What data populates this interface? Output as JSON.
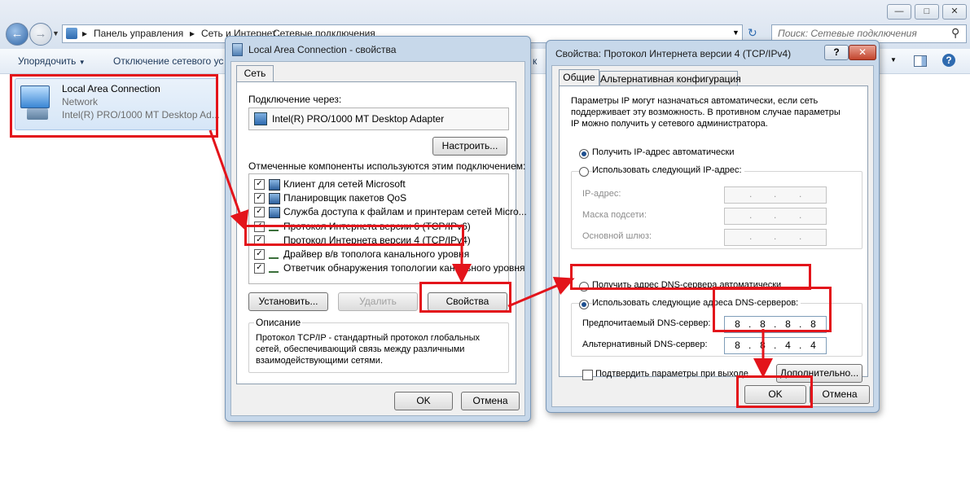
{
  "explorer": {
    "breadcrumb": [
      "Панель управления",
      "Сеть и Интернет",
      "Сетевые подключения"
    ],
    "search_placeholder": "Поиск: Сетевые подключения",
    "toolbar": {
      "organize": "Упорядочить",
      "disable": "Отключение сетевого ус",
      "partial": "к"
    },
    "connection": {
      "name": "Local Area Connection",
      "status": "Network",
      "adapter": "Intel(R) PRO/1000 MT Desktop Ad..."
    }
  },
  "lac_dialog": {
    "title": "Local Area Connection - свойства",
    "tab": "Сеть",
    "connect_using_label": "Подключение через:",
    "adapter": "Intel(R) PRO/1000 MT Desktop Adapter",
    "configure_button": "Настроить...",
    "components_label": "Отмеченные компоненты используются этим подключением:",
    "components": [
      {
        "label": "Клиент для сетей Microsoft",
        "checked": true,
        "icon": "network-client-icon"
      },
      {
        "label": "Планировщик пакетов QoS",
        "checked": true,
        "icon": "network-service-icon"
      },
      {
        "label": "Служба доступа к файлам и принтерам сетей Micro...",
        "checked": true,
        "icon": "network-service-icon"
      },
      {
        "label": "Протокол Интернета версии 6 (TCP/IPv6)",
        "checked": true,
        "icon": "protocol-icon"
      },
      {
        "label": "Протокол Интернета версии 4 (TCP/IPv4)",
        "checked": true,
        "icon": "protocol-icon"
      },
      {
        "label": "Драйвер в/в тополога канального уровня",
        "checked": true,
        "icon": "protocol-icon"
      },
      {
        "label": "Ответчик обнаружения топологии канального уровня",
        "checked": true,
        "icon": "protocol-icon"
      }
    ],
    "install_button": "Установить...",
    "remove_button": "Удалить",
    "properties_button": "Свойства",
    "description_label": "Описание",
    "description": [
      "Протокол TCP/IP - стандартный протокол глобальных",
      "сетей, обеспечивающий связь между различными",
      "взаимодействующими сетями."
    ],
    "ok_button": "OK",
    "cancel_button": "Отмена"
  },
  "ipv4_dialog": {
    "title": "Свойства: Протокол Интернета версии 4 (TCP/IPv4)",
    "help_glyph": "?",
    "tab_general": "Общие",
    "tab_alternate": "Альтернативная конфигурация",
    "intro": [
      "Параметры IP могут назначаться автоматически, если сеть",
      "поддерживает эту возможность. В противном случае параметры",
      "IP можно получить у сетевого администратора."
    ],
    "ip_auto": "Получить IP-адрес автоматически",
    "ip_manual": "Использовать следующий IP-адрес:",
    "ip_address_label": "IP-адрес:",
    "subnet_label": "Маска подсети:",
    "gateway_label": "Основной шлюз:",
    "dns_auto": "Получить адрес DNS-сервера автоматически",
    "dns_manual": "Использовать следующие адреса DNS-серверов:",
    "preferred_dns_label": "Предпочитаемый DNS-сервер:",
    "preferred_dns": [
      "8",
      "8",
      "8",
      "8"
    ],
    "alternate_dns_label": "Альтернативный DNS-сервер:",
    "alternate_dns": [
      "8",
      "8",
      "4",
      "4"
    ],
    "validate_label": "Подтвердить параметры при выходе",
    "advanced_button": "Дополнительно...",
    "ok_button": "OK",
    "cancel_button": "Отмена"
  },
  "colors": {
    "highlight": "#e3141b",
    "accent": "#1e4f8f"
  }
}
